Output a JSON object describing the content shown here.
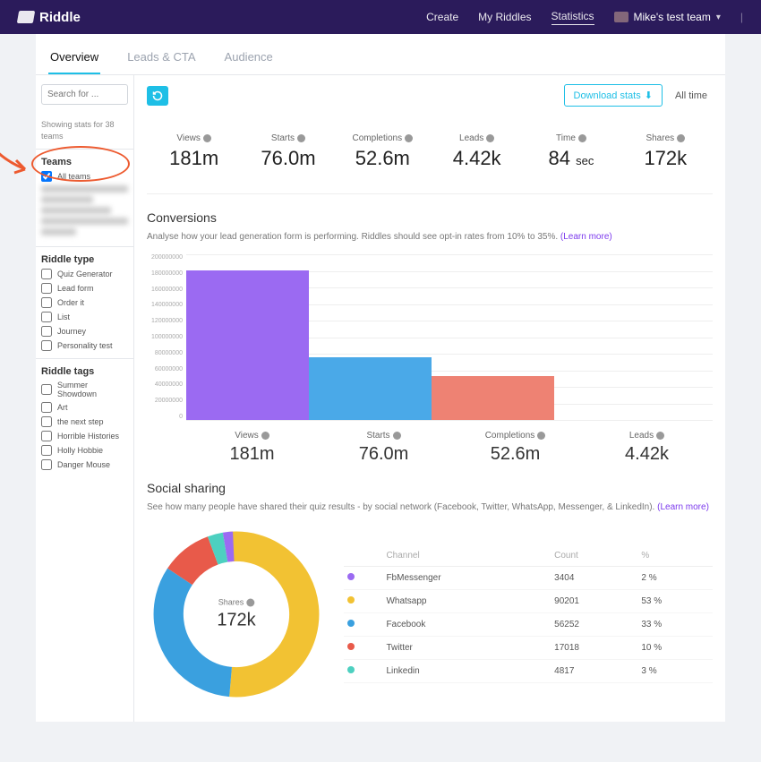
{
  "brand": "Riddle",
  "topnav": {
    "create": "Create",
    "my_riddles": "My Riddles",
    "statistics": "Statistics",
    "team": "Mike's test team"
  },
  "tabs": {
    "overview": "Overview",
    "leads": "Leads & CTA",
    "audience": "Audience"
  },
  "search": {
    "placeholder": "Search for ..."
  },
  "sidebar": {
    "showing": "Showing stats for 38 teams",
    "teams_title": "Teams",
    "all_teams": "All teams",
    "riddle_type_title": "Riddle type",
    "riddle_types": [
      "Quiz Generator",
      "Lead form",
      "Order it",
      "List",
      "Journey",
      "Personality test"
    ],
    "tags_title": "Riddle tags",
    "tags": [
      "Summer Showdown",
      "Art",
      "the next step",
      "Horrible Histories",
      "Holly Hobbie",
      "Danger Mouse"
    ]
  },
  "toolbar": {
    "download": "Download stats",
    "alltime": "All time"
  },
  "stats": {
    "views": {
      "label": "Views",
      "value": "181m"
    },
    "starts": {
      "label": "Starts",
      "value": "76.0m"
    },
    "completions": {
      "label": "Completions",
      "value": "52.6m"
    },
    "leads": {
      "label": "Leads",
      "value": "4.42k"
    },
    "time": {
      "label": "Time",
      "value": "84",
      "unit": "sec"
    },
    "shares": {
      "label": "Shares",
      "value": "172k"
    }
  },
  "conversions": {
    "title": "Conversions",
    "desc": "Analyse how your lead generation form is performing. Riddles should see opt-in rates from 10% to 35%. ",
    "learn_more": "(Learn more)"
  },
  "chart_data": {
    "type": "bar",
    "categories": [
      "Views",
      "Starts",
      "Completions",
      "Leads"
    ],
    "values": [
      181000000,
      76000000,
      52600000,
      4420
    ],
    "display_values": [
      "181m",
      "76.0m",
      "52.6m",
      "4.42k"
    ],
    "colors": [
      "#9b6af2",
      "#4aa9e8",
      "#ee8273",
      "#9b6af2"
    ],
    "ylim": [
      0,
      200000000
    ],
    "y_ticks": [
      0,
      20000000,
      40000000,
      60000000,
      80000000,
      100000000,
      120000000,
      140000000,
      160000000,
      180000000,
      200000000
    ]
  },
  "sharing": {
    "title": "Social sharing",
    "desc": "See how many people have shared their quiz results - by social network (Facebook, Twitter, WhatsApp, Messenger, & LinkedIn). ",
    "learn_more": "(Learn more)",
    "center_label": "Shares",
    "center_value": "172k",
    "table_headers": {
      "channel": "Channel",
      "count": "Count",
      "pct": "%"
    },
    "rows": [
      {
        "color": "#9b6af2",
        "channel": "FbMessenger",
        "count": "3404",
        "pct": "2 %"
      },
      {
        "color": "#f2c233",
        "channel": "Whatsapp",
        "count": "90201",
        "pct": "53 %"
      },
      {
        "color": "#3aa0df",
        "channel": "Facebook",
        "count": "56252",
        "pct": "33 %"
      },
      {
        "color": "#e85a4a",
        "channel": "Twitter",
        "count": "17018",
        "pct": "10 %"
      },
      {
        "color": "#4dd0c0",
        "channel": "Linkedin",
        "count": "4817",
        "pct": "3 %"
      }
    ],
    "donut_slices": [
      {
        "color": "#f2c233",
        "pct": 53
      },
      {
        "color": "#3aa0df",
        "pct": 33
      },
      {
        "color": "#e85a4a",
        "pct": 10
      },
      {
        "color": "#4dd0c0",
        "pct": 3
      },
      {
        "color": "#9b6af2",
        "pct": 2
      }
    ]
  }
}
